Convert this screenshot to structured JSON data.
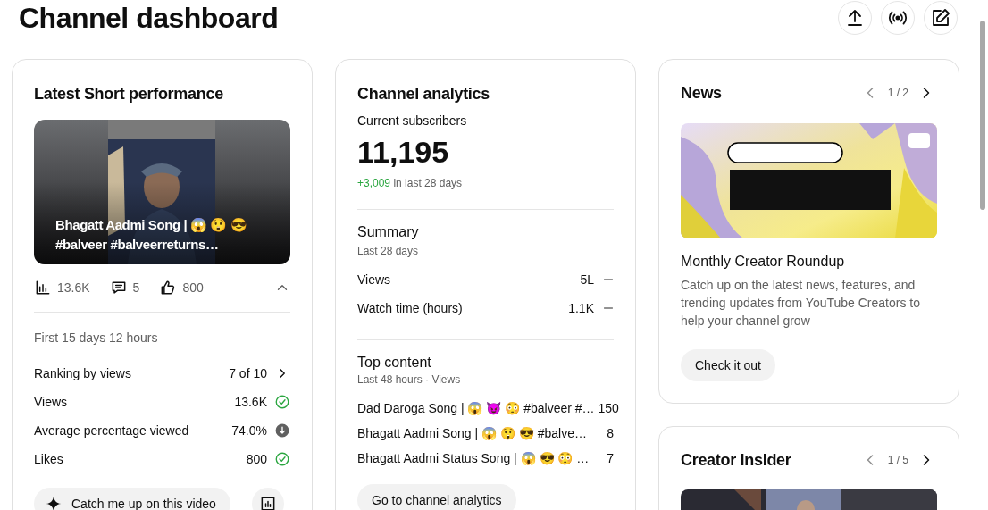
{
  "page": {
    "title": "Channel dashboard"
  },
  "header_actions": [
    {
      "kind": "upload"
    },
    {
      "kind": "live"
    },
    {
      "kind": "edit"
    }
  ],
  "short_performance": {
    "title": "Latest Short performance",
    "video_title": "Bhagatt Aadmi Song | 😱 😲 😎 #balveer #balveerreturns…",
    "views": "13.6K",
    "comments": "5",
    "likes": "800",
    "expanded": true,
    "period": "First 15 days 12 hours",
    "metrics": [
      {
        "label": "Ranking by views",
        "value": "7 of 10",
        "kind": "link"
      },
      {
        "label": "Views",
        "value": "13.6K",
        "kind": "good"
      },
      {
        "label": "Average percentage viewed",
        "value": "74.0%",
        "kind": "below"
      },
      {
        "label": "Likes",
        "value": "800",
        "kind": "good"
      }
    ],
    "buttons": [
      "Catch me up on this video"
    ]
  },
  "channel_analytics": {
    "title": "Channel analytics",
    "subscribers_label": "Current subscribers",
    "subscribers": "11,195",
    "change": "+3,009",
    "change_suffix": "in last 28 days",
    "summary": {
      "title": "Summary",
      "period": "Last 28 days",
      "rows": [
        {
          "label": "Views",
          "value": "5L",
          "kind": "flat"
        },
        {
          "label": "Watch time (hours)",
          "value": "1.1K",
          "kind": "flat"
        }
      ]
    },
    "top_content": {
      "title": "Top content",
      "period": "Last 48 hours · Views",
      "rows": [
        {
          "title": "Dad Daroga Song | 😱 😈 😳  #balveer #…",
          "views": "150"
        },
        {
          "title": "Bhagatt Aadmi Song | 😱 😲 😎  #balve…",
          "views": "8"
        },
        {
          "title": "Bhagatt Aadmi Status Song | 😱 😎 😳  …",
          "views": "7"
        }
      ]
    },
    "button": "Go to channel analytics"
  },
  "news": {
    "title": "News",
    "pager": "1 / 2",
    "prev_disabled": true,
    "next_disabled": false,
    "item_title": "Monthly Creator Roundup",
    "description": "Catch up on the latest news, features, and trending updates from YouTube Creators to help your channel grow",
    "button": "Check it out"
  },
  "creator_insider": {
    "title": "Creator Insider",
    "pager": "1 / 5",
    "prev_disabled": true,
    "next_disabled": false
  }
}
